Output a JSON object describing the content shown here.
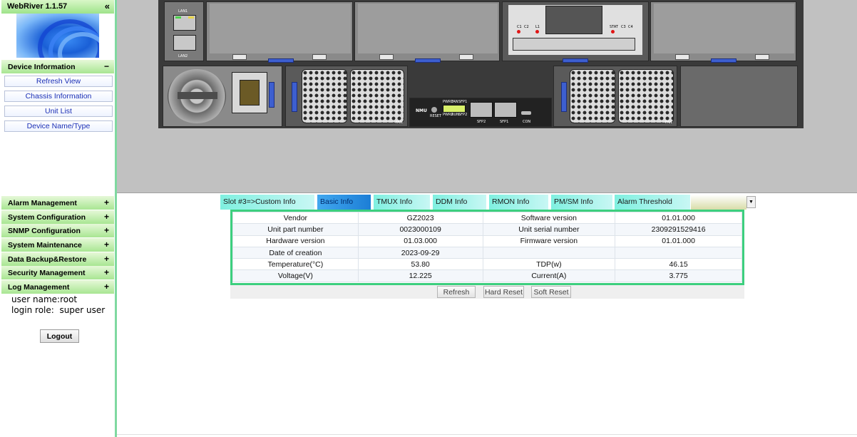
{
  "app": {
    "title": "WebRiver 1.1.57",
    "collapse_glyph": "«"
  },
  "sidebar": {
    "device_info": {
      "label": "Device Information",
      "toggle": "−"
    },
    "device_items": [
      {
        "label": "Refresh View"
      },
      {
        "label": "Chassis Information"
      },
      {
        "label": "Unit List"
      },
      {
        "label": "Device Name/Type"
      }
    ],
    "categories": [
      {
        "label": "Alarm Management",
        "toggle": "+"
      },
      {
        "label": "System Configuration",
        "toggle": "+"
      },
      {
        "label": "SNMP Configuration",
        "toggle": "+"
      },
      {
        "label": "System Maintenance",
        "toggle": "+"
      },
      {
        "label": "Data Backup&Restore",
        "toggle": "+"
      },
      {
        "label": "Security Management",
        "toggle": "+"
      },
      {
        "label": "Log Management",
        "toggle": "+"
      }
    ],
    "user_name": "user name:root",
    "login_role": "login role:  super user",
    "logout_label": "Logout"
  },
  "chassis": {
    "lan1": "LAN1",
    "lan2": "LAN2",
    "nmu": "NMU",
    "reset": "RESET",
    "pwr1": "PWR1",
    "fan": "FAN",
    "sfp1": "SFP1",
    "pwr2": "PWR2",
    "run": "RUN",
    "sfp2": "SFP2",
    "con": "CON",
    "stat": "STAT",
    "c1": "C1",
    "c2": "C2",
    "l1": "L1",
    "c3": "C3",
    "c4": "C4",
    "fan_label": "FAN"
  },
  "tabs": [
    {
      "label": "Slot #3=>Custom Info",
      "active": false
    },
    {
      "label": "Basic Info",
      "active": true
    },
    {
      "label": "TMUX Info",
      "active": false
    },
    {
      "label": "DDM Info",
      "active": false
    },
    {
      "label": "RMON Info",
      "active": false
    },
    {
      "label": "PM/SM Info",
      "active": false
    },
    {
      "label": "Alarm Threshold",
      "active": false
    }
  ],
  "tab_dropdown_glyph": "▼",
  "info_table": {
    "rows": [
      [
        "Vendor",
        "GZ2023",
        "Software version",
        "01.01.000"
      ],
      [
        "Unit part number",
        "0023000109",
        "Unit serial number",
        "2309291529416"
      ],
      [
        "Hardware version",
        "01.03.000",
        "Firmware version",
        "01.01.000"
      ],
      [
        "Date of creation",
        "2023-09-29",
        "",
        ""
      ],
      [
        "Temperature(°C)",
        "53.80",
        "TDP(w)",
        "46.15"
      ],
      [
        "Voltage(V)",
        "12.225",
        "Current(A)",
        "3.775"
      ]
    ]
  },
  "buttons": {
    "refresh": "Refresh",
    "hard_reset": "Hard Reset",
    "soft_reset": "Soft Reset"
  },
  "colors": {
    "accent_green": "#3ccf7e",
    "active_tab_blue": "#1c7ed6",
    "tab_cyan": "#7ff0e0",
    "link_blue": "#1b2fb5"
  }
}
